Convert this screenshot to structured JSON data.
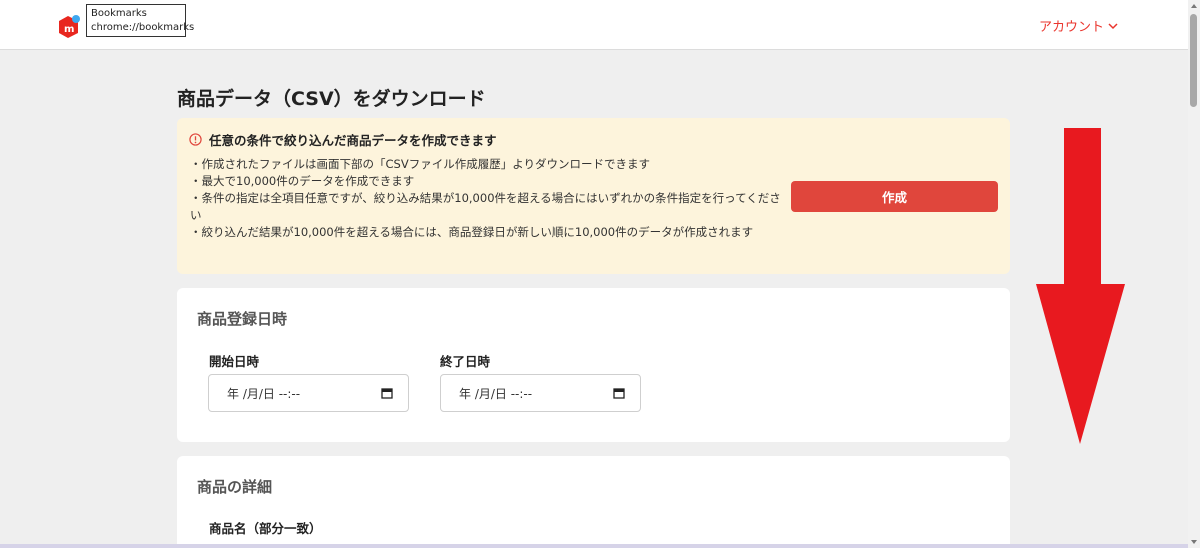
{
  "header": {
    "tooltip_line1": "Bookmarks",
    "tooltip_line2": "chrome://bookmarks",
    "account_label": "アカウント",
    "brand_color": "#ea352d"
  },
  "page": {
    "title": "商品データ（CSV）をダウンロード"
  },
  "notice": {
    "heading": "任意の条件で絞り込んだ商品データを作成できます",
    "items": [
      "・作成されたファイルは画面下部の「CSVファイル作成履歴」よりダウンロードできます",
      "・最大で10,000件のデータを作成できます",
      "・条件の指定は全項目任意ですが、絞り込み結果が10,000件を超える場合にはいずれかの条件指定を行ってください",
      "・絞り込んだ結果が10,000件を超える場合には、商品登録日が新しい順に10,000件のデータが作成されます"
    ],
    "create_button": "作成",
    "background": "#fdf4dc"
  },
  "registration": {
    "title": "商品登録日時",
    "start_label": "開始日時",
    "start_value": "年 /月/日 --:--",
    "end_label": "終了日時",
    "end_value": "年 /月/日 --:--"
  },
  "details": {
    "title": "商品の詳細",
    "name_label": "商品名（部分一致）"
  },
  "annotation": {
    "arrow_color": "#e8191f",
    "arrow_direction": "down"
  }
}
